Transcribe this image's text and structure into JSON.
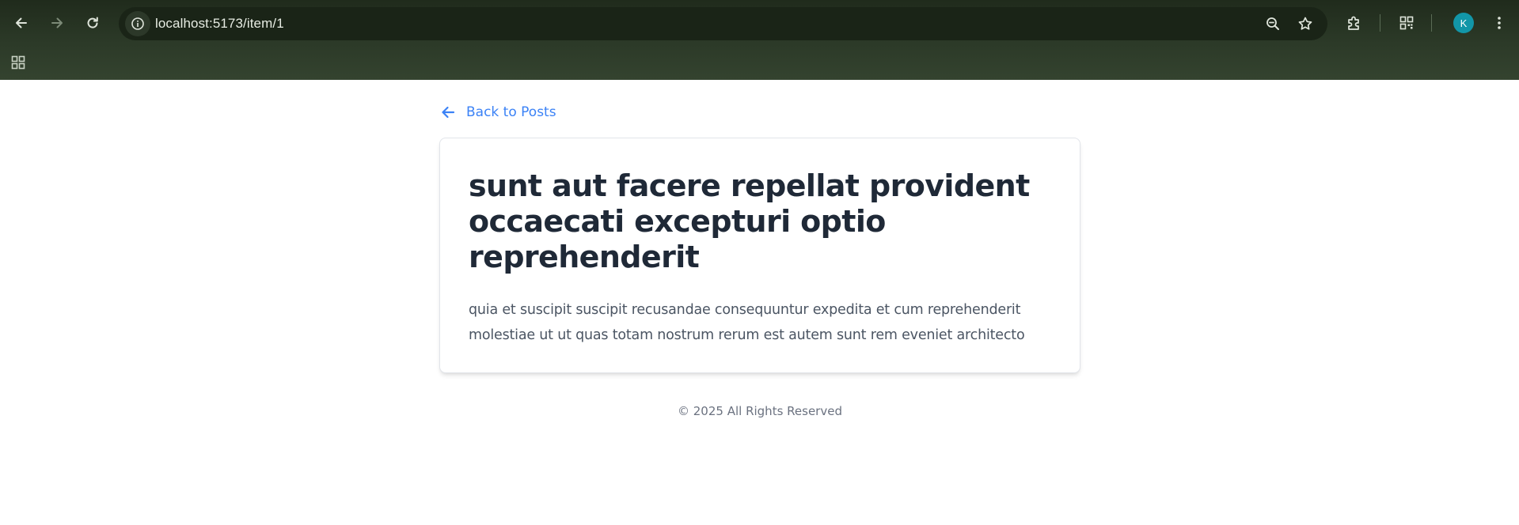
{
  "browser": {
    "url": "localhost:5173/item/1",
    "profile_initial": "K",
    "colors": {
      "chrome_bg": "#2c3a28",
      "omnibox_bg": "#1a2417",
      "avatar_bg": "#1296a8"
    },
    "icons": {
      "back": "arrow-left-icon",
      "forward": "arrow-right-icon",
      "reload": "reload-icon",
      "site_info": "info-icon",
      "zoom": "zoom-out-icon",
      "bookmark": "star-icon",
      "extensions": "puzzle-icon",
      "qr": "qr-code-icon",
      "menu": "kebab-menu-icon",
      "apps": "apps-grid-icon"
    }
  },
  "page": {
    "back_link_label": "Back to Posts",
    "post": {
      "title": "sunt aut facere repellat provident occaecati excepturi optio reprehenderit",
      "body": "quia et suscipit suscipit recusandae consequuntur expedita et cum reprehenderit molestiae ut ut quas totam nostrum rerum est autem sunt rem eveniet architecto"
    },
    "footer_text": "© 2025 All Rights Reserved",
    "colors": {
      "link": "#3b82f6",
      "title": "#1f2937",
      "body": "#4b5563",
      "footer": "#6b7280"
    }
  }
}
